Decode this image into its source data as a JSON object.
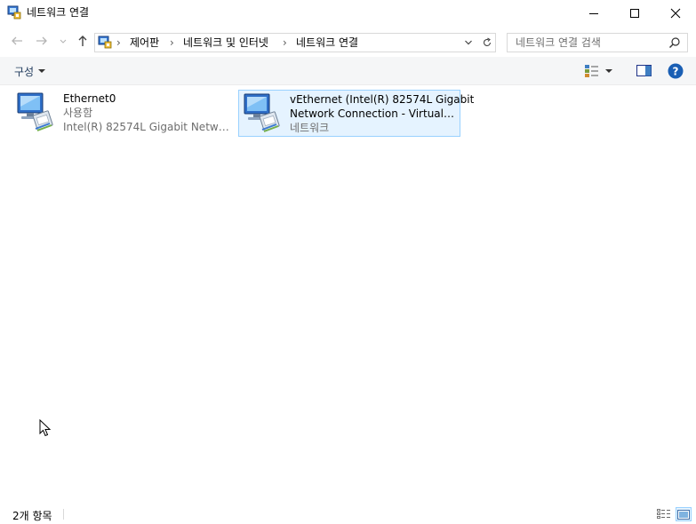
{
  "window": {
    "title": "네트워크 연결",
    "controls": {
      "minimize": "minimize",
      "maximize": "maximize",
      "close": "close"
    }
  },
  "address": {
    "breadcrumbs": [
      "제어판",
      "네트워크 및 인터넷",
      "네트워크 연결"
    ]
  },
  "search": {
    "placeholder": "네트워크 연결 검색"
  },
  "toolbar": {
    "organize_label": "구성"
  },
  "items": [
    {
      "name": "Ethernet0",
      "status": "사용함",
      "device": "Intel(R) 82574L Gigabit Network ..."
    },
    {
      "name": "vEthernet (Intel(R) 82574L Gigabit",
      "name_line2": "Network Connection - Virtual S...",
      "status": "네트워크",
      "selected": true
    }
  ],
  "status": {
    "item_count": "2개 항목"
  },
  "colors": {
    "accent": "#1e3287",
    "selection_bg": "#e5f3ff",
    "selection_border": "#99d1ff",
    "command_bar_bg": "#f5f6f7",
    "help_blue": "#1a5fb4"
  }
}
